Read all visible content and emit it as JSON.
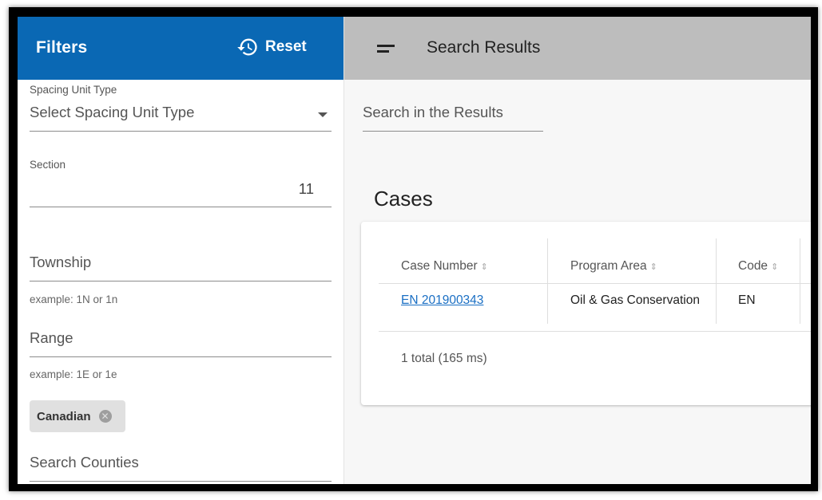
{
  "sidebar": {
    "title": "Filters",
    "reset_label": "Reset",
    "spacing_unit": {
      "label": "Spacing Unit Type",
      "placeholder": "Select Spacing Unit Type"
    },
    "section": {
      "label": "Section",
      "value": "11"
    },
    "township": {
      "placeholder": "Township",
      "hint": "example: 1N or 1n"
    },
    "range": {
      "placeholder": "Range",
      "hint": "example: 1E or 1e"
    },
    "county_chip": {
      "label": "Canadian"
    },
    "counties": {
      "placeholder": "Search Counties"
    }
  },
  "main": {
    "title": "Search Results",
    "search_placeholder": "Search in the Results",
    "cases_title": "Cases",
    "table": {
      "columns": [
        "Case Number",
        "Program Area",
        "Code"
      ],
      "rows": [
        {
          "case_number": "EN 201900343",
          "program_area": "Oil & Gas Conservation",
          "code": "EN"
        }
      ]
    },
    "total_text": "1 total (165 ms)"
  },
  "colors": {
    "header_blue": "#0a68b4",
    "topbar_gray": "#bdbdbd",
    "link_blue": "#1a6fc4"
  },
  "icons": {
    "reset": "history-icon",
    "menu": "menu-icon",
    "dropdown": "chevron-down-icon",
    "chip_remove": "close-circle-icon",
    "sort": "sort-icon"
  }
}
